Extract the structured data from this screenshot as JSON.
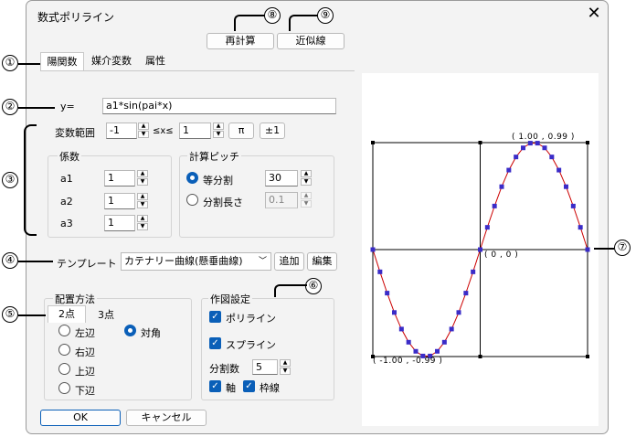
{
  "dialog": {
    "title": "数式ポリライン",
    "recalc_label": "再計算",
    "approx_label": "近似線",
    "ok_label": "OK",
    "cancel_label": "キャンセル"
  },
  "tabs": [
    {
      "label": "陽関数",
      "selected": true
    },
    {
      "label": "媒介変数",
      "selected": false
    },
    {
      "label": "属性",
      "selected": false
    }
  ],
  "formula": {
    "label": "y=",
    "value": "a1*sin(pai*x)"
  },
  "range": {
    "label": "変数範囲",
    "min": "-1",
    "mid": "≤x≤",
    "max": "1",
    "pi_label": "π",
    "pm1_label": "±1"
  },
  "coef": {
    "title": "係数",
    "items": [
      {
        "label": "a1",
        "value": "1"
      },
      {
        "label": "a2",
        "value": "1"
      },
      {
        "label": "a3",
        "value": "1"
      }
    ]
  },
  "pitch": {
    "title": "計算ピッチ",
    "equal_label": "等分割",
    "equal_value": "30",
    "length_label": "分割長さ",
    "length_value": "0.1"
  },
  "template": {
    "label": "テンプレート",
    "value": "カテナリー曲線(懸垂曲線)",
    "add_label": "追加",
    "edit_label": "編集"
  },
  "placement": {
    "title": "配置方法",
    "tab1": "2点",
    "tab2": "3点",
    "left": "左辺",
    "right": "右辺",
    "top": "上辺",
    "bottom": "下辺",
    "diag": "対角"
  },
  "drawing": {
    "title": "作図設定",
    "polyline": "ポリライン",
    "spline": "スプライン",
    "div_label": "分割数",
    "div_value": "5",
    "axis": "軸",
    "frame": "枠線"
  },
  "plot": {
    "max_label": "( 1.00 , 0.99 )",
    "origin_label": "( 0 , 0 )",
    "min_label": "( -1.00 , -0.99 )"
  },
  "chart_data": {
    "type": "line",
    "function": "sin(pi*x)",
    "xlim": [
      -1,
      1
    ],
    "ylim": [
      -1,
      1
    ],
    "x": [
      -1.0,
      -0.9333,
      -0.8667,
      -0.8,
      -0.7333,
      -0.6667,
      -0.6,
      -0.5333,
      -0.4667,
      -0.4,
      -0.3333,
      -0.2667,
      -0.2,
      -0.1333,
      -0.0667,
      0.0,
      0.0667,
      0.1333,
      0.2,
      0.2667,
      0.3333,
      0.4,
      0.4667,
      0.5333,
      0.6,
      0.6667,
      0.7333,
      0.8,
      0.8667,
      0.9333,
      1.0
    ],
    "y": [
      0.0,
      -0.208,
      -0.407,
      -0.588,
      -0.743,
      -0.866,
      -0.951,
      -0.995,
      -0.995,
      -0.951,
      -0.866,
      -0.743,
      -0.588,
      -0.407,
      -0.208,
      0.0,
      0.208,
      0.407,
      0.588,
      0.743,
      0.866,
      0.951,
      0.995,
      0.995,
      0.951,
      0.866,
      0.743,
      0.588,
      0.407,
      0.208,
      0.0
    ],
    "line_color": "#cc0000",
    "marker_color": "#3a2cc8"
  },
  "annotations": [
    "①",
    "②",
    "③",
    "④",
    "⑤",
    "⑥",
    "⑦",
    "⑧",
    "⑨"
  ]
}
